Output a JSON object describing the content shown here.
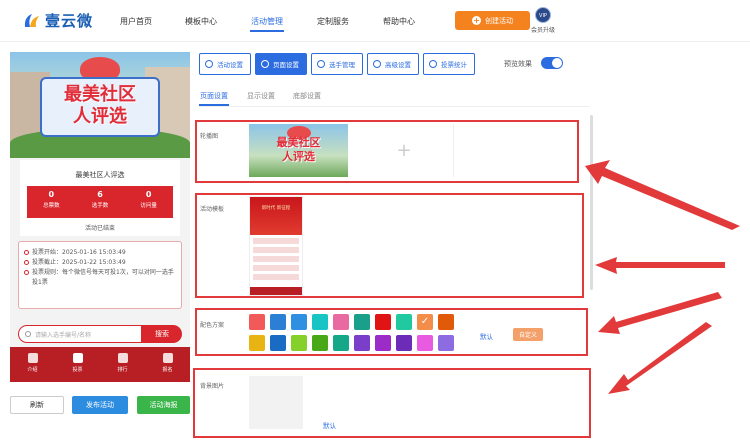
{
  "header": {
    "logo_text": "壹云微",
    "nav": [
      {
        "label": "用户首页",
        "active": false
      },
      {
        "label": "模板中心",
        "active": false
      },
      {
        "label": "活动管理",
        "active": true
      },
      {
        "label": "定制服务",
        "active": false
      },
      {
        "label": "帮助中心",
        "active": false
      }
    ],
    "create_label": "创建活动",
    "vip_badge": "VIP",
    "vip_label": "会员升级"
  },
  "preview": {
    "banner_line1": "最美社区",
    "banner_line2": "人评选",
    "activity_title": "最美社区人评选",
    "stats": [
      {
        "value": "0",
        "label": "总票数"
      },
      {
        "value": "6",
        "label": "选手数"
      },
      {
        "value": "0",
        "label": "访问量"
      }
    ],
    "status": "活动已结束",
    "rules": [
      "投票开始：2025-01-16 15:03:49",
      "投票截止：2025-01-22 15:03:49",
      "投票规则：每个微信号每天可投1次，可以对同一选手投1票"
    ],
    "search_placeholder": "请输入选手编号/名称",
    "search_button": "搜索",
    "tabs": [
      "介绍",
      "投票",
      "排行",
      "报名"
    ]
  },
  "bottom_buttons": {
    "refresh": "刷新",
    "publish": "发布活动",
    "poster": "活动海报"
  },
  "toolbar": {
    "items": [
      {
        "label": "活动设置",
        "icon": "gear-icon",
        "active": false
      },
      {
        "label": "页面设置",
        "icon": "gear-icon",
        "active": true
      },
      {
        "label": "选手管理",
        "icon": "users-icon",
        "active": false
      },
      {
        "label": "高级设置",
        "icon": "sliders-icon",
        "active": false
      },
      {
        "label": "投票统计",
        "icon": "chart-icon",
        "active": false
      }
    ],
    "preview_label": "预览效果",
    "preview_on": true
  },
  "subtabs": [
    {
      "label": "页面设置",
      "active": true
    },
    {
      "label": "显示设置",
      "active": false
    },
    {
      "label": "底部设置",
      "active": false
    }
  ],
  "sections": {
    "carousel_label": "轮播图",
    "carousel_text_line1": "最美社区",
    "carousel_text_line2": "人评选",
    "add_symbol": "+",
    "template_label": "活动模板",
    "template_head": "新时代 新征程",
    "color_label": "配色方案",
    "default_label": "默认",
    "custom_label": "自定义",
    "background_label": "背景图片",
    "bg_default_label": "默认"
  },
  "colors": {
    "row1": [
      "#f25a5a",
      "#2b7fd4",
      "#2f8fe0",
      "#18c4c4",
      "#e96aa0",
      "#1aa08a",
      "#e01414",
      "#20c9a0",
      "#f48c4a",
      "#e05a0a"
    ],
    "row2": [
      "#e8b414",
      "#1a6bc4",
      "#86d02c",
      "#48a818",
      "#14a888",
      "#7a3ec8",
      "#9c2cc8",
      "#6c2cb8",
      "#e85ae0",
      "#8c6ce0"
    ],
    "checked_index_row1": 8,
    "accent": "#2b6de0",
    "annotation_red": "#e23a3a"
  }
}
